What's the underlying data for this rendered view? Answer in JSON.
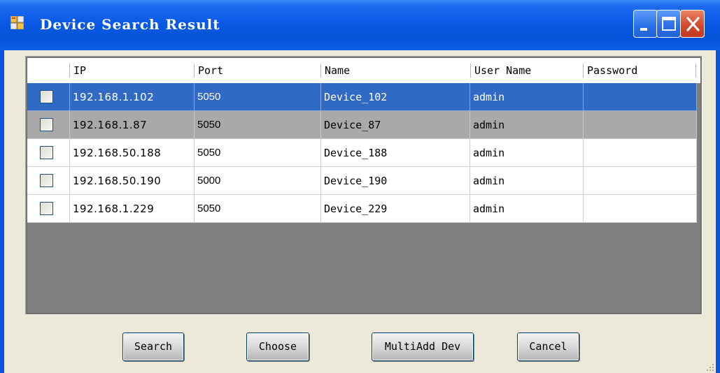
{
  "window": {
    "title": "Device Search Result"
  },
  "table": {
    "columns": [
      "IP",
      "Port",
      "Name",
      "User Name",
      "Password"
    ],
    "rows": [
      {
        "checked": false,
        "state": "selected",
        "ip": "192.168.1.102",
        "port": "5050",
        "name": "Device_102",
        "user": "admin",
        "password": ""
      },
      {
        "checked": false,
        "state": "selected-inactive",
        "ip": "192.168.1.87",
        "port": "5050",
        "name": "Device_87",
        "user": "admin",
        "password": ""
      },
      {
        "checked": false,
        "state": "normal",
        "ip": "192.168.50.188",
        "port": "5050",
        "name": "Device_188",
        "user": "admin",
        "password": ""
      },
      {
        "checked": false,
        "state": "normal",
        "ip": "192.168.50.190",
        "port": "5000",
        "name": "Device_190",
        "user": "admin",
        "password": ""
      },
      {
        "checked": false,
        "state": "normal",
        "ip": "192.168.1.229",
        "port": "5050",
        "name": "Device_229",
        "user": "admin",
        "password": ""
      }
    ]
  },
  "buttons": {
    "search": "Search",
    "choose": "Choose",
    "multiadd": "MultiAdd Dev",
    "cancel": "Cancel"
  },
  "colors": {
    "titlebar": "#0a5ae6",
    "selected_row": "#316ac5",
    "inactive_row": "#a9a9a9",
    "grid_bg": "#808080",
    "dialog_bg": "#ece9d8"
  },
  "icons": {
    "app": "app-grid-icon",
    "minimize": "minimize-icon",
    "maximize": "maximize-icon",
    "close": "close-icon"
  }
}
